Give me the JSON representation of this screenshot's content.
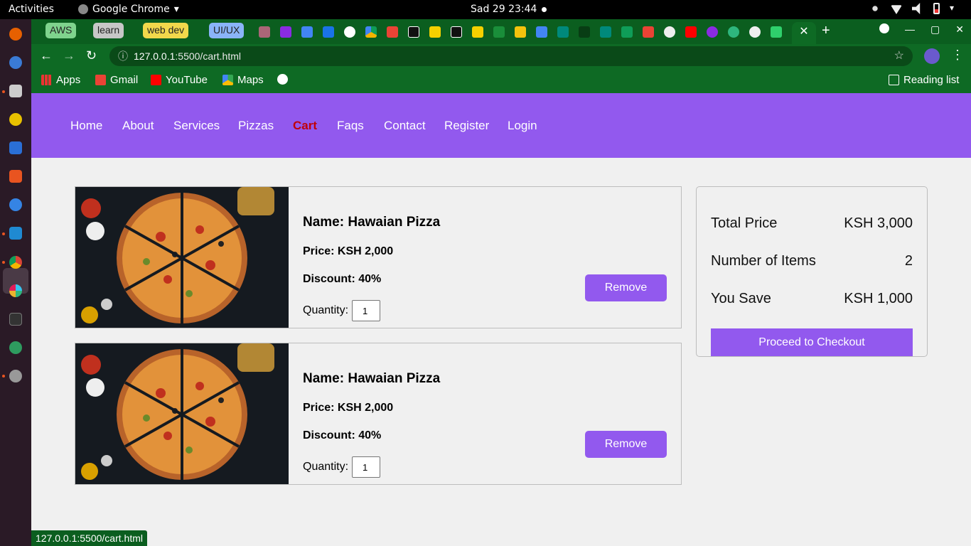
{
  "os": {
    "activities": "Activities",
    "app_name": "Google Chrome",
    "clock": "Sad 29  23:44"
  },
  "browser": {
    "tab_groups": [
      "AWS",
      "learn",
      "web dev",
      "UI/UX"
    ],
    "url_host": "127.0.0.1",
    "url_rest": ":5500/cart.html",
    "bookmarks": [
      "Apps",
      "Gmail",
      "YouTube",
      "Maps"
    ],
    "reading_list": "Reading list",
    "status_url": "127.0.0.1:5500/cart.html"
  },
  "nav": {
    "items": [
      "Home",
      "About",
      "Services",
      "Pizzas",
      "Cart",
      "Faqs",
      "Contact",
      "Register",
      "Login"
    ],
    "active": "Cart"
  },
  "cart": {
    "items": [
      {
        "name": "Name: Hawaian Pizza",
        "price": "Price: KSH 2,000",
        "discount": "Discount: 40%",
        "qty_label": "Quantity:",
        "qty": "1",
        "remove": "Remove"
      },
      {
        "name": "Name: Hawaian Pizza",
        "price": "Price: KSH 2,000",
        "discount": "Discount: 40%",
        "qty_label": "Quantity:",
        "qty": "1",
        "remove": "Remove"
      }
    ]
  },
  "summary": {
    "total_label": "Total Price",
    "total_value": "KSH 3,000",
    "items_label": "Number of Items",
    "items_value": "2",
    "save_label": "You Save",
    "save_value": "KSH 1,000",
    "checkout": "Proceed to Checkout"
  },
  "colors": {
    "brand": "#9259ee",
    "active_link": "#c0000a",
    "chrome_theme": "#0e6a24"
  }
}
